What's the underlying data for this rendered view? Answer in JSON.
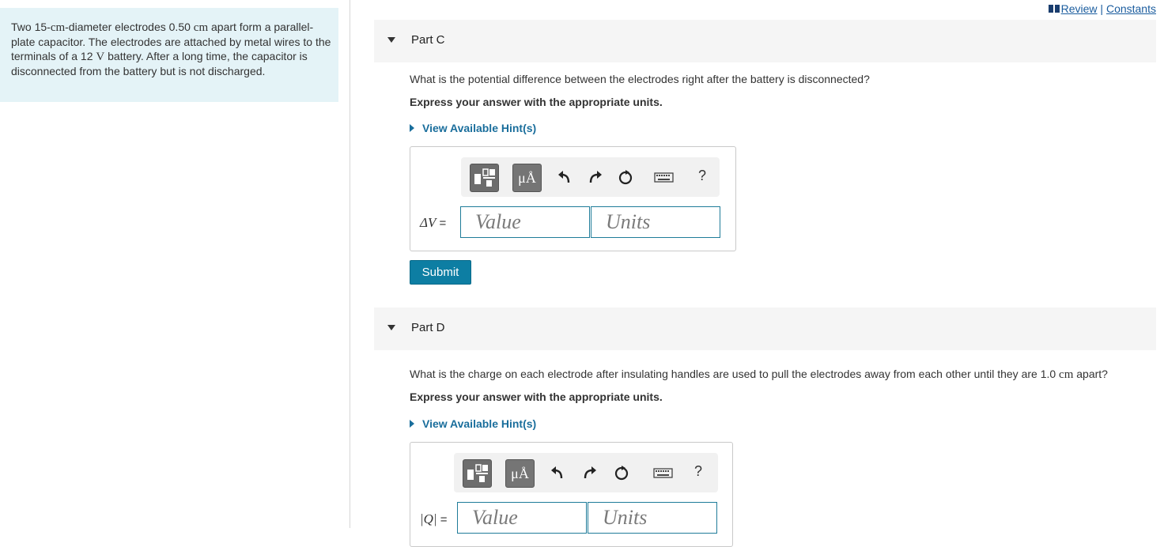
{
  "header": {
    "review_label": "Review",
    "separator": "|",
    "constants_label": "Constants"
  },
  "problem": {
    "segments": [
      "Two 15-",
      "cm",
      "-diameter electrodes 0.50 ",
      "cm",
      " apart form a parallel-plate capacitor. The electrodes are attached by metal wires to the terminals of a 12 ",
      "V",
      " battery. After a long time, the capacitor is disconnected from the battery but is not discharged."
    ]
  },
  "parts": [
    {
      "title": "Part C",
      "question": "What is the potential difference between the electrodes right after the battery is disconnected?",
      "express": "Express your answer with the appropriate units.",
      "hint": "View Available Hint(s)",
      "variable": "ΔV",
      "equals": "=",
      "value_placeholder": "Value",
      "units_placeholder": "Units",
      "submit": "Submit"
    },
    {
      "title": "Part D",
      "question_segments": [
        "What is the charge on each electrode after insulating handles are used to pull the electrodes away from each other until they are 1.0 ",
        "cm",
        " apart?"
      ],
      "express": "Express your answer with the appropriate units.",
      "hint": "View Available Hint(s)",
      "variable": "|Q|",
      "equals": "=",
      "value_placeholder": "Value",
      "units_placeholder": "Units"
    }
  ],
  "toolbar": {
    "units_button": "μÅ",
    "help": "?"
  },
  "colors": {
    "accent": "#0d7ea3",
    "hint": "#1a6e9c",
    "panel": "#e4f3f7",
    "link": "#1a5c9e"
  }
}
